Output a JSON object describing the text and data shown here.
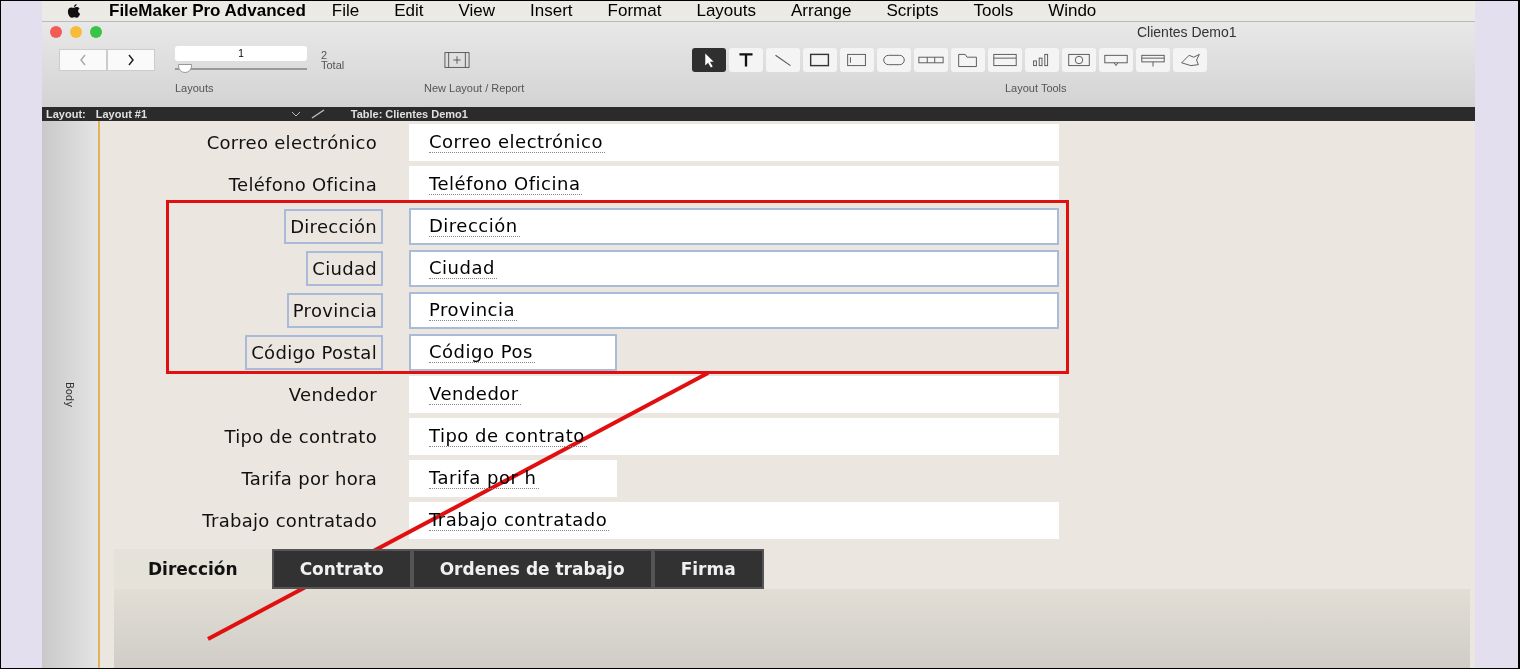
{
  "menu_bar": {
    "app": "FileMaker Pro Advanced",
    "items": [
      "File",
      "Edit",
      "View",
      "Insert",
      "Format",
      "Layouts",
      "Arrange",
      "Scripts",
      "Tools",
      "Windo"
    ]
  },
  "window": {
    "title": "Clientes Demo1"
  },
  "toolbar": {
    "record": "1",
    "count": "2",
    "count_label": "Total",
    "slider": {
      "level": 0.02
    },
    "layouts_label": "Layouts",
    "new_layout_label": "New Layout / Report",
    "tools_label": "Layout Tools",
    "tools": [
      {
        "kind": "pointer",
        "selected": true
      },
      {
        "kind": "text",
        "selected": false
      },
      {
        "kind": "line",
        "selected": false
      },
      {
        "kind": "rect",
        "selected": false
      },
      {
        "kind": "field",
        "selected": false
      },
      {
        "kind": "button",
        "selected": false
      },
      {
        "kind": "buttonbar",
        "selected": false
      },
      {
        "kind": "tab",
        "selected": false
      },
      {
        "kind": "slide",
        "selected": false
      },
      {
        "kind": "chart",
        "selected": false
      },
      {
        "kind": "web",
        "selected": false
      },
      {
        "kind": "popover",
        "selected": false
      },
      {
        "kind": "portal",
        "selected": false
      },
      {
        "kind": "brush",
        "selected": false
      }
    ]
  },
  "layout_bar": {
    "label": "Layout:",
    "layout": "Layout #1",
    "table": "Table: Clientes Demo1"
  },
  "part_label": "Body",
  "fields": [
    {
      "label": "Correo electrónico",
      "value": "Correo electrónico",
      "selected": false,
      "kind": "full"
    },
    {
      "label": "Teléfono Oficina",
      "value": "Teléfono Oficina",
      "selected": false,
      "kind": "full"
    },
    {
      "label": "Dirección",
      "value": "Dirección",
      "selected": true,
      "kind": "full"
    },
    {
      "label": "Ciudad",
      "value": "Ciudad",
      "selected": true,
      "kind": "full"
    },
    {
      "label": "Provincia",
      "value": "Provincia",
      "selected": true,
      "kind": "full"
    },
    {
      "label": "Código Postal",
      "value": "Código Pos",
      "selected": true,
      "kind": "short"
    },
    {
      "label": "Vendedor",
      "value": "Vendedor",
      "selected": false,
      "kind": "full"
    },
    {
      "label": "Tipo de contrato",
      "value": "Tipo de contrato",
      "selected": false,
      "kind": "full"
    },
    {
      "label": "Tarifa por hora",
      "value": "Tarifa por h",
      "selected": false,
      "kind": "short"
    },
    {
      "label": "Trabajo contratado",
      "value": "Trabajo contratado",
      "selected": false,
      "kind": "full"
    }
  ],
  "tabs": [
    {
      "label": "Dirección",
      "selected": true
    },
    {
      "label": "Contrato",
      "selected": false
    },
    {
      "label": "Ordenes de trabajo",
      "selected": false
    },
    {
      "label": "Firma",
      "selected": false
    }
  ]
}
